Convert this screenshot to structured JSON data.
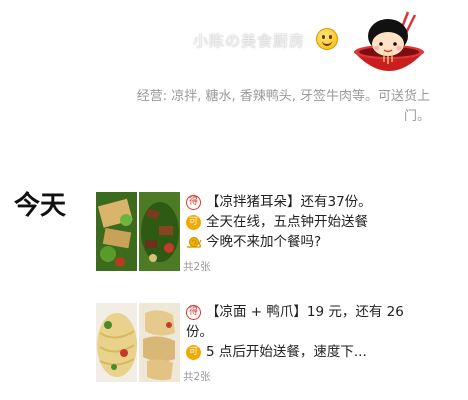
{
  "profile": {
    "name": "小陈の美食厨房",
    "business": "经营: 凉拌, 糖水, 香辣鸭头, 牙签牛肉等。可送货上门。"
  },
  "timeline": {
    "day_label": "今天",
    "posts": [
      {
        "line1": "【凉拌猪耳朵】还有37份。",
        "line2": "全天在线，五点钟开始送餐",
        "line3": "今晚不来加个餐吗?",
        "image_count": "共2张"
      },
      {
        "line1": "【凉面 + 鸭爪】19 元，还有 26",
        "line1b": "份。",
        "line2": "5 点后开始送餐，速度下...",
        "image_count": "共2张"
      }
    ]
  },
  "badges": {
    "de": "得",
    "ke": "可"
  },
  "colors": {
    "accent_red": "#e0352b",
    "accent_orange": "#f2a900"
  },
  "icons": [
    "smile-emoji-icon",
    "avatar-cartoon",
    "snail-icon"
  ]
}
